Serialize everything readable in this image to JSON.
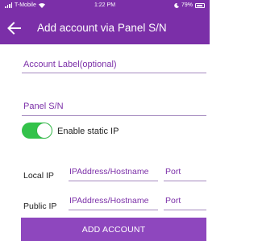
{
  "status_bar": {
    "carrier": "T-Mobile",
    "time": "1:22 PM",
    "battery": "79%"
  },
  "app_bar": {
    "title": "Add account via Panel S/N",
    "back_icon": "back-arrow-icon"
  },
  "form": {
    "account_label_placeholder": "Account Label(optional)",
    "panel_sn_placeholder": "Panel S/N",
    "static_ip_label": "Enable static IP",
    "static_ip_enabled": true,
    "local_ip": {
      "label": "Local IP",
      "address_placeholder": "IPAddress/Hostname",
      "port_placeholder": "Port"
    },
    "public_ip": {
      "label": "Public IP",
      "address_placeholder": "IPAddress/Hostname",
      "port_placeholder": "Port"
    }
  },
  "actions": {
    "add_account_label": "ADD ACCOUNT"
  },
  "colors": {
    "primary": "#7b2fa8",
    "button": "#8e47be",
    "toggle_on": "#33c24a"
  }
}
